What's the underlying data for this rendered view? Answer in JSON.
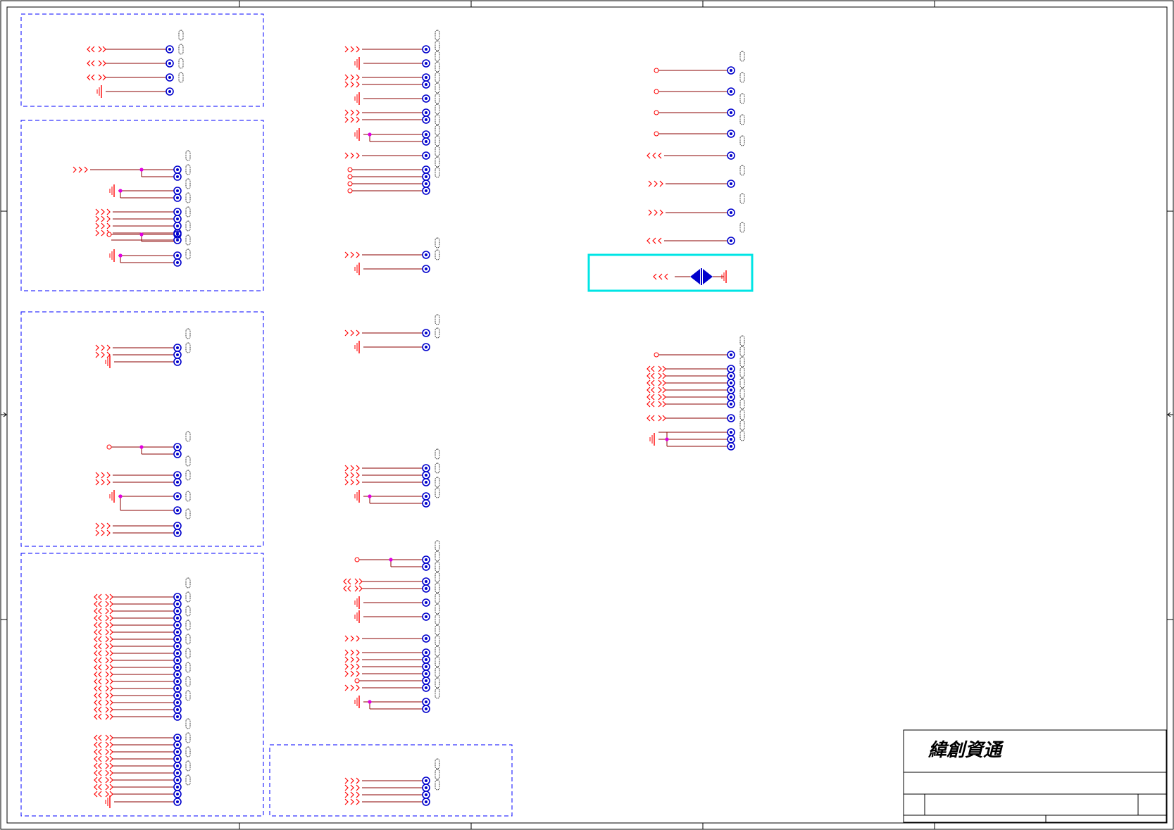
{
  "title_block": {
    "company": "緯創資通"
  },
  "colors": {
    "wire": "#8b0000",
    "port": "#ff0000",
    "pad": "#0000cc",
    "junction": "#e000e0",
    "dashed_box": "#0000ff",
    "highlight": "#00e5e5",
    "border": "#000000"
  },
  "icons": {
    "pad": "test-pad-icon",
    "ground": "ground-icon",
    "port_in": "offpage-input-icon",
    "port_out": "offpage-output-icon",
    "port_bidir": "offpage-bidir-icon",
    "open_end": "open-terminal-icon",
    "refdes": "refdes-placeholder-icon",
    "diode": "bidirectional-diode-icon"
  }
}
